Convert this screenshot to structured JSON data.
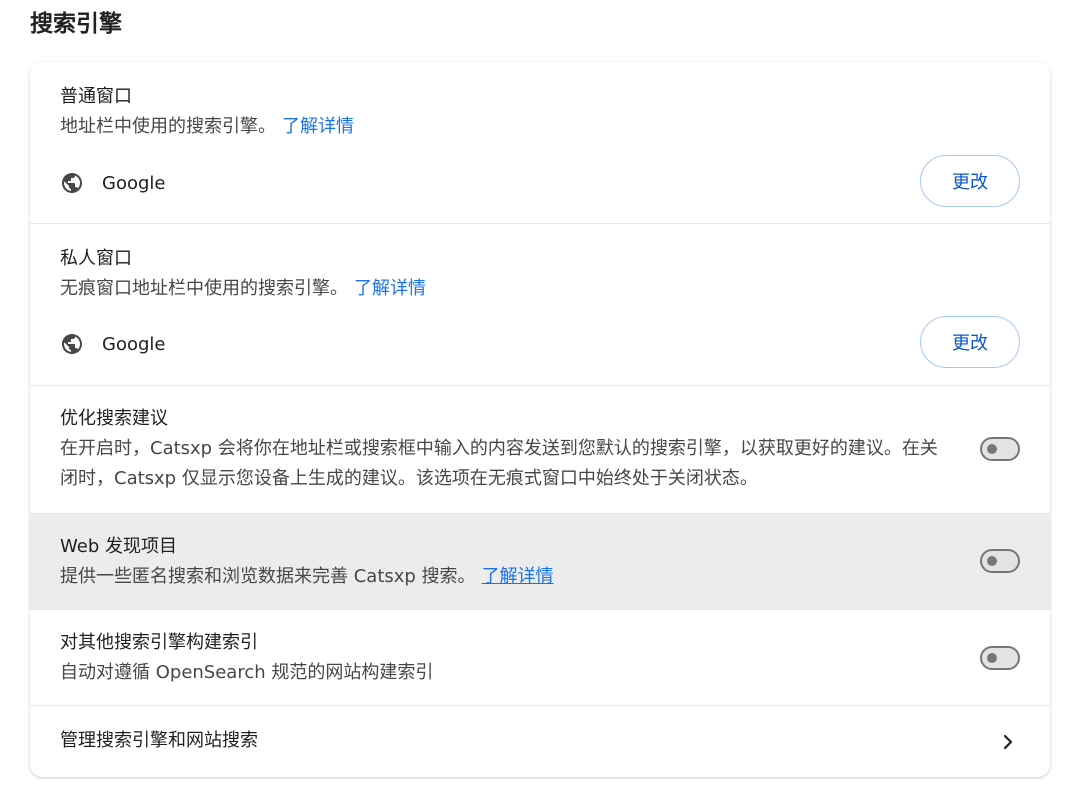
{
  "page": {
    "title": "搜索引擎"
  },
  "normal_window": {
    "title": "普通窗口",
    "desc": "地址栏中使用的搜索引擎。",
    "link": "了解详情",
    "engine": "Google",
    "change_label": "更改"
  },
  "private_window": {
    "title": "私人窗口",
    "desc": "无痕窗口地址栏中使用的搜索引擎。",
    "link": "了解详情",
    "engine": "Google",
    "change_label": "更改"
  },
  "suggestions": {
    "title": "优化搜索建议",
    "desc": "在开启时，Catsxp 会将你在地址栏或搜索框中输入的内容发送到您默认的搜索引擎，以获取更好的建议。在关闭时，Catsxp 仅显示您设备上生成的建议。该选项在无痕式窗口中始终处于关闭状态。",
    "enabled": false
  },
  "web_discovery": {
    "title": "Web 发现项目",
    "desc": "提供一些匿名搜索和浏览数据来完善 Catsxp 搜索。",
    "link": "了解详情",
    "enabled": false,
    "hover_bg": "#ececec"
  },
  "index_other": {
    "title": "对其他搜索引擎构建索引",
    "desc": "自动对遵循 OpenSearch 规范的网站构建索引",
    "enabled": false
  },
  "manage": {
    "title": "管理搜索引擎和网站搜索",
    "icon": "chevron-right-icon"
  },
  "colors": {
    "link": "#1a73e8",
    "button_border": "#a8c7fa",
    "button_text": "#0b57d0",
    "toggle_off": "#747775"
  }
}
